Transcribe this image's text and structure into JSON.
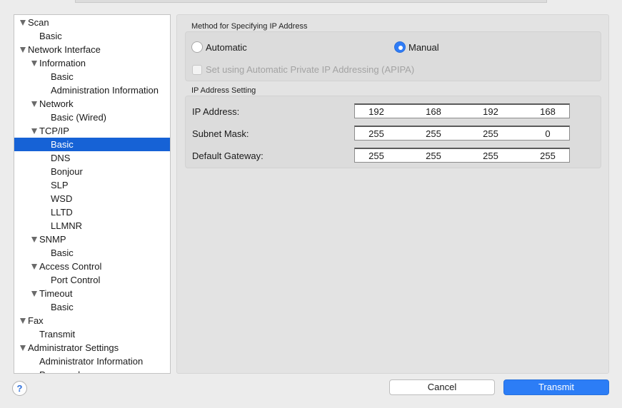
{
  "tree": [
    {
      "label": "Scan",
      "level": 0,
      "expanded": true
    },
    {
      "label": "Basic",
      "level": 1
    },
    {
      "label": "Network Interface",
      "level": 0,
      "expanded": true
    },
    {
      "label": "Information",
      "level": 1,
      "expanded": true
    },
    {
      "label": "Basic",
      "level": 2
    },
    {
      "label": "Administration Information",
      "level": 2
    },
    {
      "label": "Network",
      "level": 1,
      "expanded": true
    },
    {
      "label": "Basic (Wired)",
      "level": 2
    },
    {
      "label": "TCP/IP",
      "level": 1,
      "expanded": true
    },
    {
      "label": "Basic",
      "level": 2,
      "selected": true
    },
    {
      "label": "DNS",
      "level": 2
    },
    {
      "label": "Bonjour",
      "level": 2
    },
    {
      "label": "SLP",
      "level": 2
    },
    {
      "label": "WSD",
      "level": 2
    },
    {
      "label": "LLTD",
      "level": 2
    },
    {
      "label": "LLMNR",
      "level": 2
    },
    {
      "label": "SNMP",
      "level": 1,
      "expanded": true
    },
    {
      "label": "Basic",
      "level": 2
    },
    {
      "label": "Access Control",
      "level": 1,
      "expanded": true
    },
    {
      "label": "Port Control",
      "level": 2
    },
    {
      "label": "Timeout",
      "level": 1,
      "expanded": true
    },
    {
      "label": "Basic",
      "level": 2
    },
    {
      "label": "Fax",
      "level": 0,
      "expanded": true
    },
    {
      "label": "Transmit",
      "level": 1
    },
    {
      "label": "Administrator Settings",
      "level": 0,
      "expanded": true
    },
    {
      "label": "Administrator Information",
      "level": 1
    },
    {
      "label": "Password",
      "level": 1
    }
  ],
  "method": {
    "title": "Method for Specifying IP Address",
    "automatic_label": "Automatic",
    "manual_label": "Manual",
    "selected": "manual",
    "apipa_label": "Set using Automatic Private IP Addressing (APIPA)",
    "apipa_checked": false
  },
  "ip_setting": {
    "title": "IP Address Setting",
    "fields": [
      {
        "label": "IP Address:",
        "octets": [
          "192",
          "168",
          "192",
          "168"
        ]
      },
      {
        "label": "Subnet Mask:",
        "octets": [
          "255",
          "255",
          "255",
          "0"
        ]
      },
      {
        "label": "Default Gateway:",
        "octets": [
          "255",
          "255",
          "255",
          "255"
        ]
      }
    ]
  },
  "footer": {
    "help_label": "?",
    "cancel_label": "Cancel",
    "transmit_label": "Transmit"
  },
  "colors": {
    "selection": "#1662d6",
    "primary_button": "#2c7df6"
  }
}
